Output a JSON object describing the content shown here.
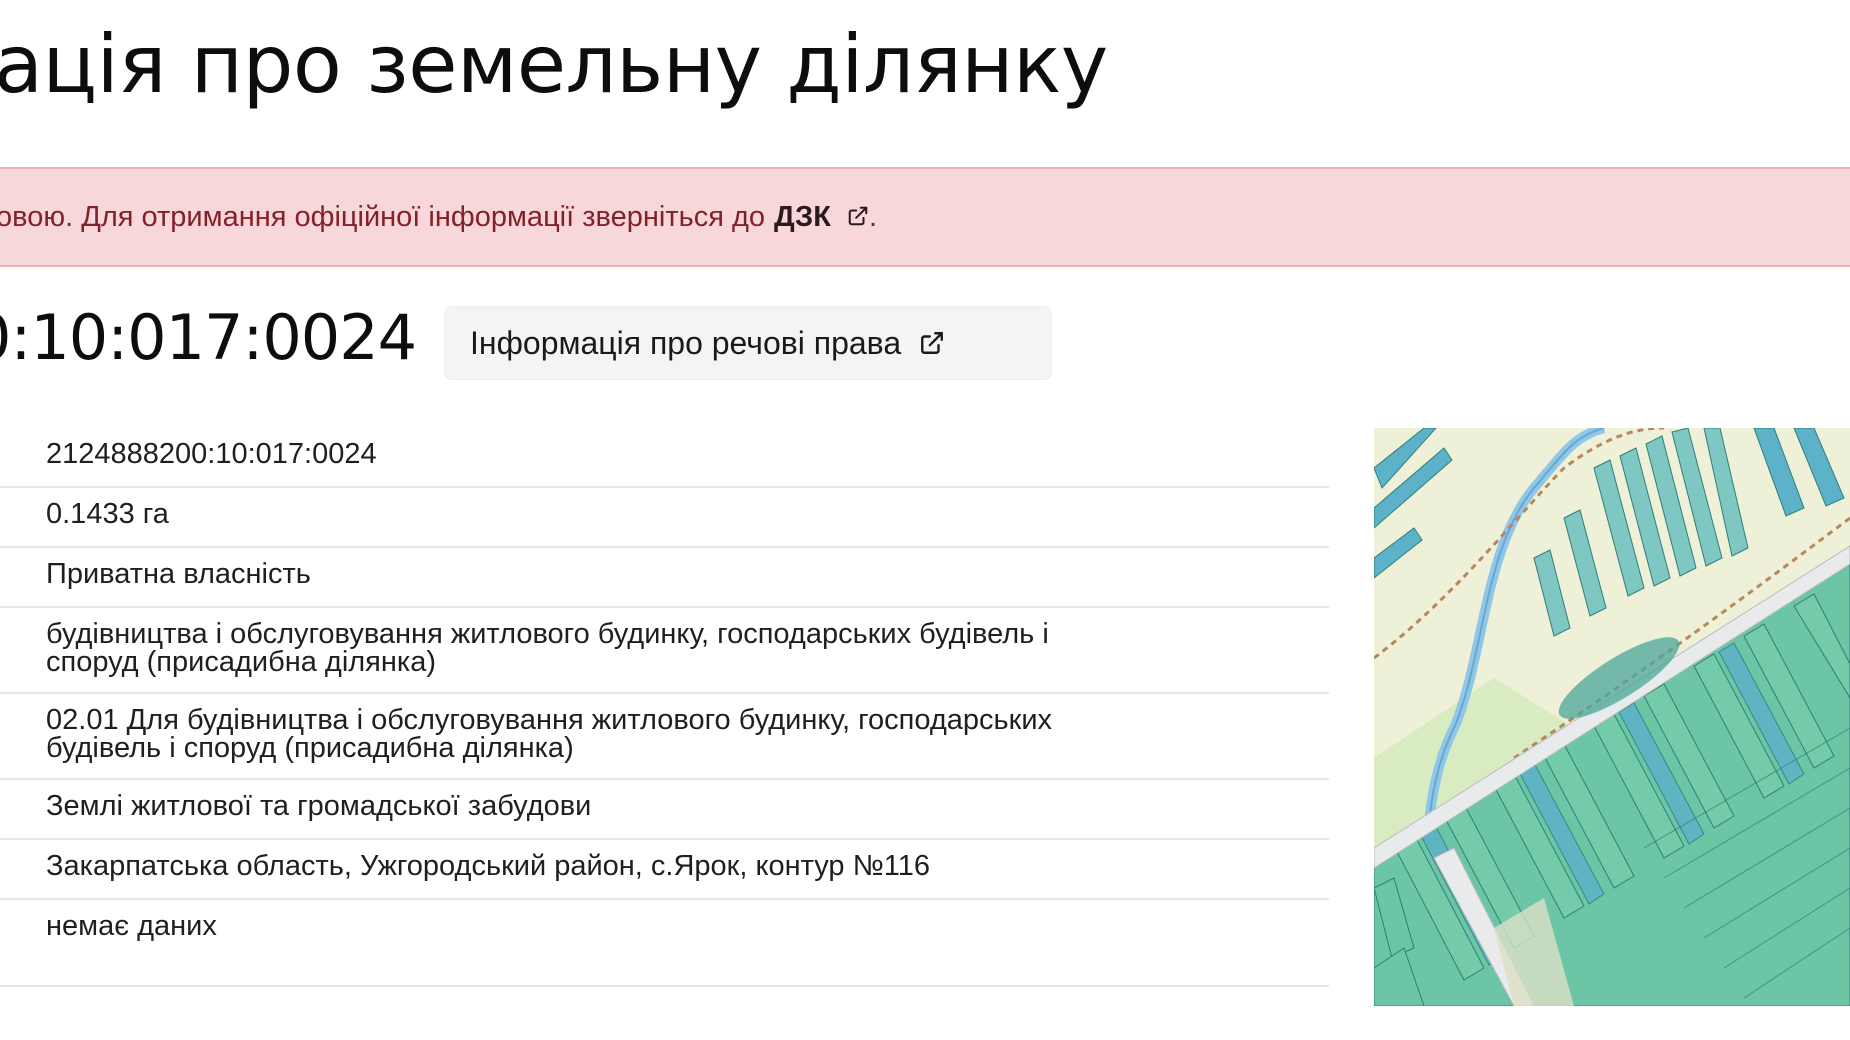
{
  "page": {
    "title": "ація про земельну ділянку"
  },
  "alert": {
    "text": "овою. Для отримання офіційної інформації зверніться до",
    "link_label": "ДЗК",
    "suffix": "."
  },
  "parcel": {
    "cadastral_number_display": "0:10:017:0024",
    "rights_button_label": "Інформація про речові права"
  },
  "details": {
    "rows": [
      {
        "value": "2124888200:10:017:0024"
      },
      {
        "value": "0.1433 га"
      },
      {
        "value": "Приватна власність"
      },
      {
        "value_line1": "будівництва і обслуговування житлового будинку, господарських будівель і",
        "value_line2": "споруд (присадибна ділянка)"
      },
      {
        "value_line1": "02.01 Для будівництва і обслуговування житлового будинку, господарських",
        "value_line2": "будівель і споруд (присадибна ділянка)"
      },
      {
        "value": "Землі житлової та громадської забудови"
      },
      {
        "value": "Закарпатська область, Ужгородський район, с.Ярок, контур №116"
      },
      {
        "value": "немає даних"
      }
    ]
  },
  "map": {
    "colors": {
      "background": "#eef0d8",
      "parcel_fill": "#6cc6a6",
      "parcel_alt_fill": "#5db2c9",
      "parcel_stroke": "#2f7f76",
      "road": "#e9eaec",
      "river": "#8ec7e8",
      "boundary": "#b9875a"
    }
  },
  "icons": {
    "external_link": "external-link-icon"
  }
}
